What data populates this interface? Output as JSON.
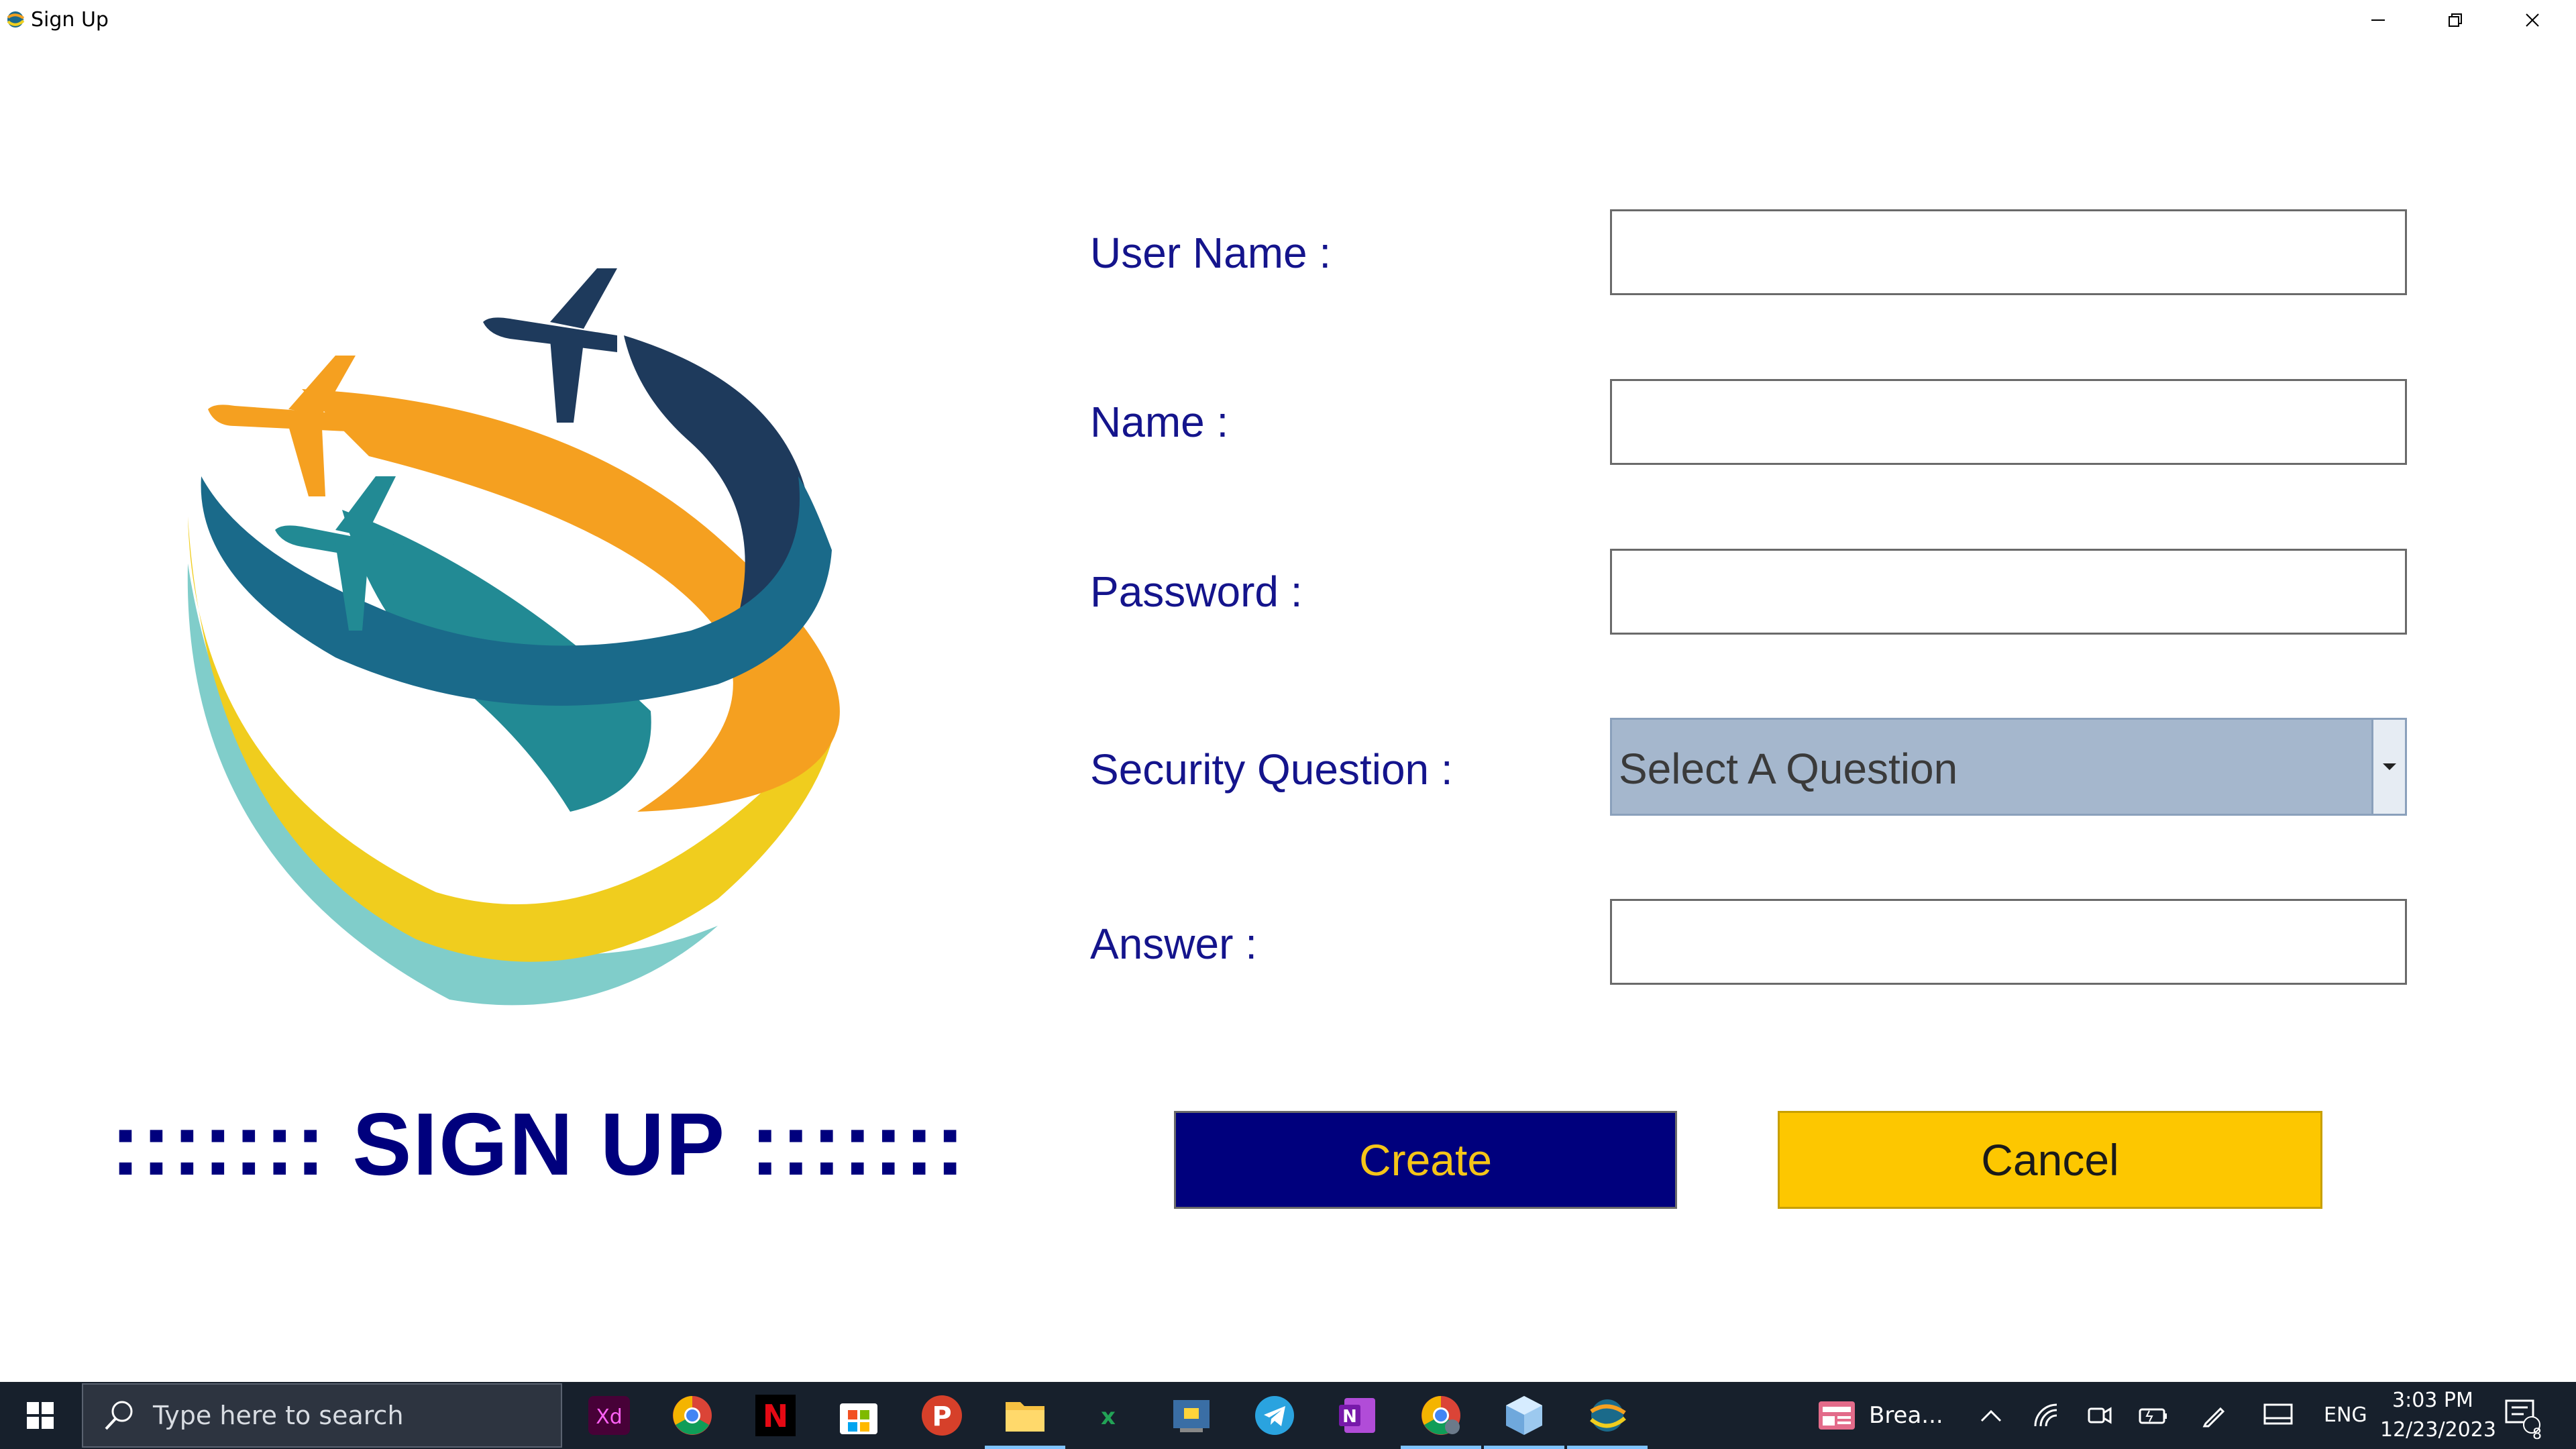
{
  "window": {
    "title": "Sign Up"
  },
  "form": {
    "labels": {
      "user_name": "User Name :",
      "name": "Name :",
      "password": "Password :",
      "security_question": "Security Question :",
      "answer": "Answer :"
    },
    "values": {
      "user_name": "",
      "name": "",
      "password": "",
      "answer": ""
    },
    "security_question_selected": "Select A Question",
    "heading": "::::::: SIGN UP :::::::"
  },
  "buttons": {
    "create": "Create",
    "cancel": "Cancel"
  },
  "colors": {
    "label_text": "#14148c",
    "heading": "#00007d",
    "create_bg": "#00007d",
    "create_text": "#f5c518",
    "cancel_bg": "#fdc700",
    "select_bg": "#a5b7cd",
    "taskbar_bg": "#17202c"
  },
  "taskbar": {
    "search_placeholder": "Type here to search",
    "apps": [
      "xd-icon",
      "chrome-icon",
      "netflix-icon",
      "store-icon",
      "p-app-icon",
      "file-explorer-icon",
      "excel-icon",
      "python-icon",
      "telegram-icon",
      "onenote-icon",
      "chrome-profile-icon",
      "cube-app-icon",
      "signup-app-icon"
    ],
    "news_label": "Brea...",
    "language": "ENG",
    "time": "3:03 PM",
    "date": "12/23/2023",
    "notification_count": "8"
  }
}
